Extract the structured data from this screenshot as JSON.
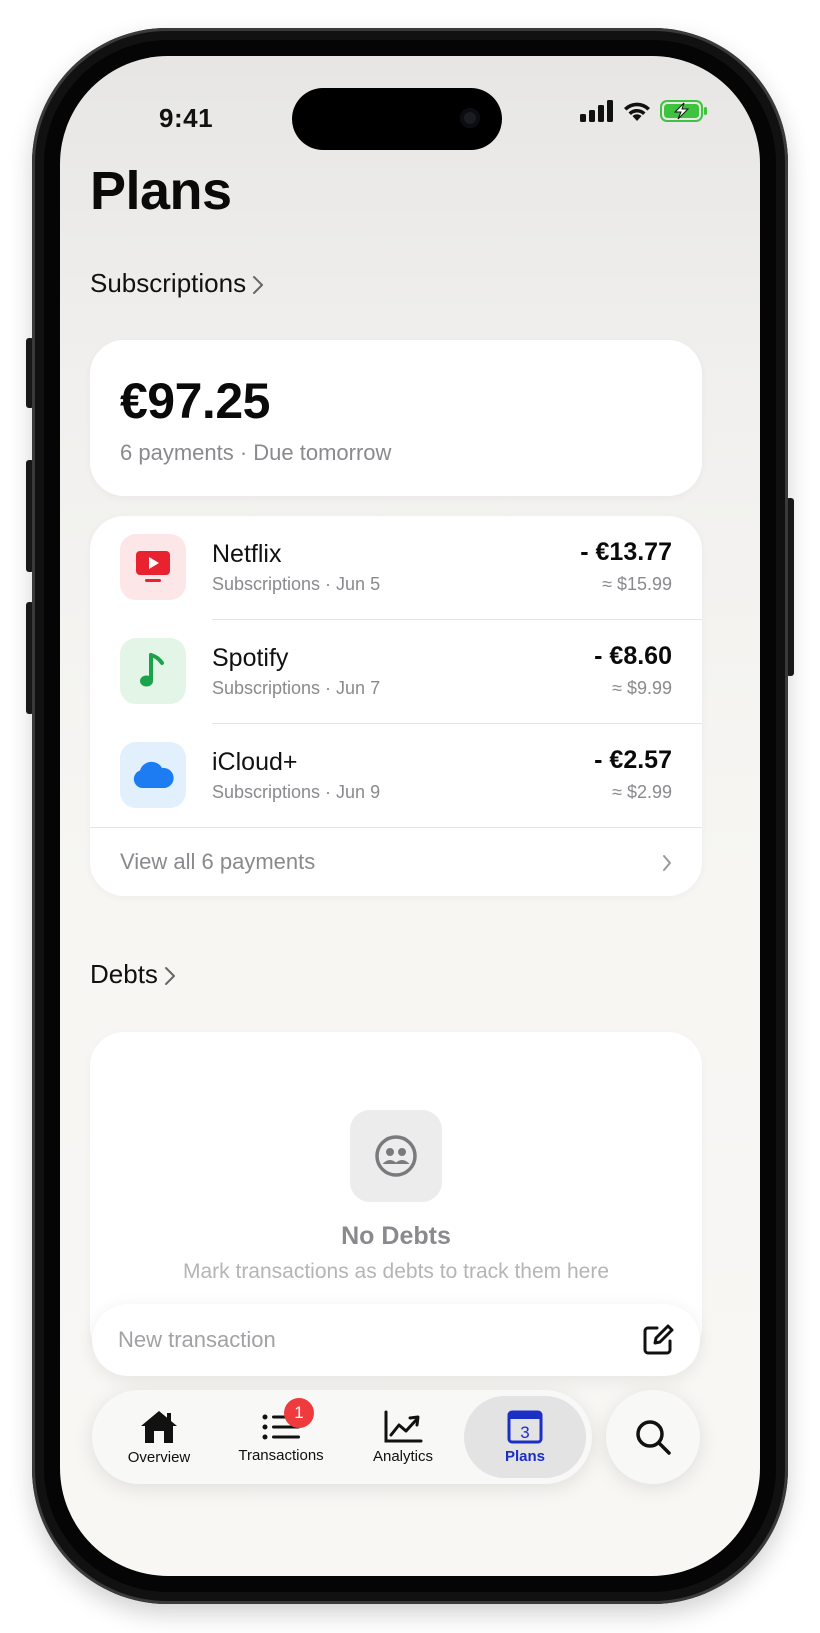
{
  "status": {
    "time": "9:41"
  },
  "header": {
    "title": "Plans"
  },
  "subscriptions": {
    "section_label": "Subscriptions",
    "total": "€97.25",
    "summary": "6 payments · Due tomorrow",
    "items": [
      {
        "name": "Netflix",
        "meta": "Subscriptions · Jun 5",
        "amount": "- €13.77",
        "converted": "≈ $15.99",
        "icon": "tv-play-icon",
        "color": "#e8232f"
      },
      {
        "name": "Spotify",
        "meta": "Subscriptions · Jun 7",
        "amount": "- €8.60",
        "converted": "≈ $9.99",
        "icon": "music-note-icon",
        "color": "#1aa34a"
      },
      {
        "name": "iCloud+",
        "meta": "Subscriptions · Jun 9",
        "amount": "- €2.57",
        "converted": "≈ $2.99",
        "icon": "cloud-icon",
        "color": "#1e7cf2"
      }
    ],
    "view_all": "View all 6 payments"
  },
  "debts": {
    "section_label": "Debts",
    "empty_title": "No Debts",
    "empty_subtitle": "Mark transactions as debts to track them here"
  },
  "composer": {
    "placeholder": "New transaction"
  },
  "tabbar": {
    "tabs": [
      {
        "label": "Overview",
        "icon": "house-icon"
      },
      {
        "label": "Transactions",
        "icon": "list-icon",
        "badge": "1"
      },
      {
        "label": "Analytics",
        "icon": "chart-icon"
      },
      {
        "label": "Plans",
        "icon": "calendar-icon",
        "icon_text": "3",
        "active": true
      }
    ],
    "accent": "#1c2fc4"
  }
}
